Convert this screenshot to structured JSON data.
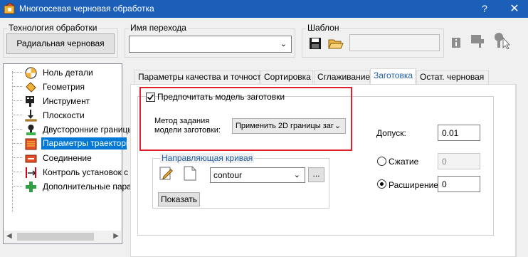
{
  "window": {
    "title": "Многоосевая черновая обработка",
    "help_icon": "question-mark-icon",
    "close_icon": "close-icon"
  },
  "top": {
    "tech_group_label": "Технология обработки",
    "tech_button": "Радиальная черновая",
    "op_name_label": "Имя перехода",
    "op_name_value": "",
    "template_label": "Шаблон",
    "template_value": ""
  },
  "tree": {
    "items": [
      {
        "label": "Ноль детали",
        "icon": "part-zero-icon"
      },
      {
        "label": "Геометрия",
        "icon": "geometry-icon"
      },
      {
        "label": "Инструмент",
        "icon": "tool-icon"
      },
      {
        "label": "Плоскости",
        "icon": "planes-icon"
      },
      {
        "label": "Двусторонние границы",
        "icon": "two-sided-boundaries-icon"
      },
      {
        "label": "Параметры траектории",
        "icon": "toolpath-params-icon"
      },
      {
        "label": "Соединение",
        "icon": "link-icon"
      },
      {
        "label": "Контроль установок с",
        "icon": "setup-control-icon"
      },
      {
        "label": "Дополнительные пара",
        "icon": "additional-params-icon"
      }
    ],
    "selected_index": 5
  },
  "tabs": [
    {
      "label": "Параметры качества и точности"
    },
    {
      "label": "Сортировка"
    },
    {
      "label": "Сглаживание"
    },
    {
      "label": "Заготовка"
    },
    {
      "label": "Остат. черновая"
    }
  ],
  "active_tab": 3,
  "stock": {
    "prefer_label": "Предпочитать модель заготовки",
    "prefer_checked": true,
    "method_label_1": "Метод задания",
    "method_label_2": "модели заготовки:",
    "method_value": "Применить 2D границы заг",
    "guide_curve_label": "Направляющая кривая",
    "curve_value": "contour",
    "ellipsis": "...",
    "show_button": "Показать",
    "tolerance_label": "Допуск:",
    "tolerance_value": "0.01",
    "compression_label": "Сжатие",
    "compression_value": "0",
    "expansion_label": "Расширение",
    "expansion_value": "0",
    "radio_selected": "expansion"
  },
  "colors": {
    "titlebar": "#1c5fb8",
    "highlight_border": "#e0202c",
    "selection": "#0078d7"
  }
}
